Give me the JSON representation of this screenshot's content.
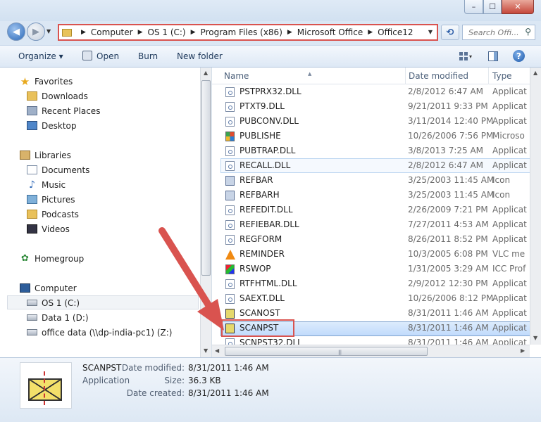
{
  "window": {
    "controls": {
      "minimize": "–",
      "maximize": "☐",
      "close": "✕"
    }
  },
  "navigation": {
    "back_icon": "◀",
    "forward_icon": "▶",
    "breadcrumbs": [
      "Computer",
      "OS 1 (C:)",
      "Program Files (x86)",
      "Microsoft Office",
      "Office12"
    ],
    "refresh_icon": "⟲",
    "search_placeholder": "Search Offi...",
    "search_icon": "⚲"
  },
  "toolbar": {
    "organize": "Organize ▾",
    "open": "Open",
    "burn": "Burn",
    "new_folder": "New folder",
    "views_drop": "▾",
    "help": "?"
  },
  "sidebar": {
    "favorites": {
      "label": "Favorites",
      "items": [
        "Downloads",
        "Recent Places",
        "Desktop"
      ]
    },
    "libraries": {
      "label": "Libraries",
      "items": [
        "Documents",
        "Music",
        "Pictures",
        "Podcasts",
        "Videos"
      ]
    },
    "homegroup": "Homegroup",
    "computer": {
      "label": "Computer",
      "items": [
        "OS 1 (C:)",
        "Data 1 (D:)",
        "office data (\\\\dp-india-pc1) (Z:)"
      ]
    },
    "selected": "OS 1 (C:)"
  },
  "files": {
    "columns": {
      "name": "Name",
      "date": "Date modified",
      "type": "Type"
    },
    "rows": [
      {
        "name": "PSTPRX32.DLL",
        "date": "2/8/2012 6:47 AM",
        "type": "Applicat",
        "icon": "dll"
      },
      {
        "name": "PTXT9.DLL",
        "date": "9/21/2011 9:33 PM",
        "type": "Applicat",
        "icon": "dll"
      },
      {
        "name": "PUBCONV.DLL",
        "date": "3/11/2014 12:40 PM",
        "type": "Applicat",
        "icon": "dll"
      },
      {
        "name": "PUBLISHE",
        "date": "10/26/2006 7:56 PM",
        "type": "Microso",
        "icon": "pub"
      },
      {
        "name": "PUBTRAP.DLL",
        "date": "3/8/2013 7:25 AM",
        "type": "Applicat",
        "icon": "dll"
      },
      {
        "name": "RECALL.DLL",
        "date": "2/8/2012 6:47 AM",
        "type": "Applicat",
        "icon": "dll"
      },
      {
        "name": "REFBAR",
        "date": "3/25/2003 11:45 AM",
        "type": "Icon",
        "icon": "ico"
      },
      {
        "name": "REFBARH",
        "date": "3/25/2003 11:45 AM",
        "type": "Icon",
        "icon": "ico"
      },
      {
        "name": "REFEDIT.DLL",
        "date": "2/26/2009 7:21 PM",
        "type": "Applicat",
        "icon": "dll"
      },
      {
        "name": "REFIEBAR.DLL",
        "date": "7/27/2011 4:53 AM",
        "type": "Applicat",
        "icon": "dll"
      },
      {
        "name": "REGFORM",
        "date": "8/26/2011 8:52 PM",
        "type": "Applicat",
        "icon": "dll"
      },
      {
        "name": "REMINDER",
        "date": "10/3/2005 6:08 PM",
        "type": "VLC me",
        "icon": "vlc"
      },
      {
        "name": "RSWOP",
        "date": "1/31/2005 3:29 AM",
        "type": "ICC Prof",
        "icon": "icc"
      },
      {
        "name": "RTFHTML.DLL",
        "date": "2/9/2012 12:30 PM",
        "type": "Applicat",
        "icon": "dll"
      },
      {
        "name": "SAEXT.DLL",
        "date": "10/26/2006 8:12 PM",
        "type": "Applicat",
        "icon": "dll"
      },
      {
        "name": "SCANOST",
        "date": "8/31/2011 1:46 AM",
        "type": "Applicat",
        "icon": "scan"
      },
      {
        "name": "SCANPST",
        "date": "8/31/2011 1:46 AM",
        "type": "Applicat",
        "icon": "scan"
      },
      {
        "name": "SCNPST32.DLL",
        "date": "8/31/2011 1:46 AM",
        "type": "Applicat",
        "icon": "dll"
      }
    ],
    "hover_index": 5,
    "selected_index": 16
  },
  "details": {
    "name": "SCANPST",
    "kind": "Application",
    "modified_label": "Date modified:",
    "modified": "8/31/2011 1:46 AM",
    "size_label": "Size:",
    "size": "36.3 KB",
    "created_label": "Date created:",
    "created": "8/31/2011 1:46 AM"
  },
  "colors": {
    "annotation": "#d9534f",
    "selection": "#c1dbfc"
  }
}
